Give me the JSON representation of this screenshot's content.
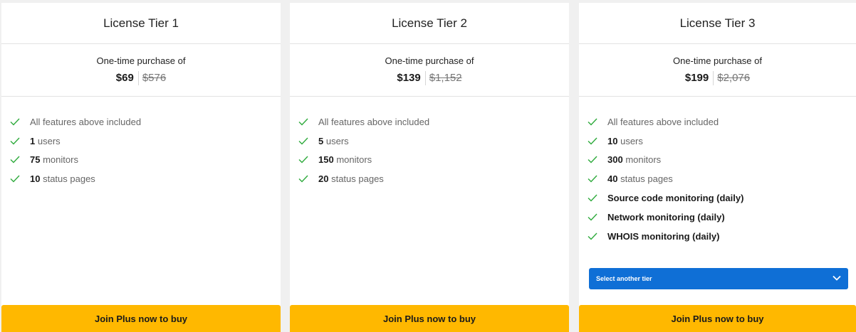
{
  "colors": {
    "check": "#2eaa3c",
    "buy_button": "#ffb800",
    "select": "#0f6fd6"
  },
  "tiers": [
    {
      "title": "License Tier 1",
      "price_caption": "One-time purchase of",
      "price_now": "$69",
      "price_old": "$576",
      "features": {
        "included": "All features above included",
        "users_value": "1",
        "users_label": "users",
        "monitors_value": "75",
        "monitors_label": "monitors",
        "pages_value": "10",
        "pages_label": "status pages"
      },
      "buy_label": "Join Plus now to buy"
    },
    {
      "title": "License Tier 2",
      "price_caption": "One-time purchase of",
      "price_now": "$139",
      "price_old": "$1,152",
      "features": {
        "included": "All features above included",
        "users_value": "5",
        "users_label": "users",
        "monitors_value": "150",
        "monitors_label": "monitors",
        "pages_value": "20",
        "pages_label": "status pages"
      },
      "buy_label": "Join Plus now to buy"
    },
    {
      "title": "License Tier 3",
      "price_caption": "One-time purchase of",
      "price_now": "$199",
      "price_old": "$2,076",
      "features": {
        "included": "All features above included",
        "users_value": "10",
        "users_label": "users",
        "monitors_value": "300",
        "monitors_label": "monitors",
        "pages_value": "40",
        "pages_label": "status pages",
        "source_code": "Source code monitoring (daily)",
        "network": "Network monitoring (daily)",
        "whois": "WHOIS monitoring (daily)"
      },
      "select_label": "Select another tier",
      "buy_label": "Join Plus now to buy"
    }
  ]
}
